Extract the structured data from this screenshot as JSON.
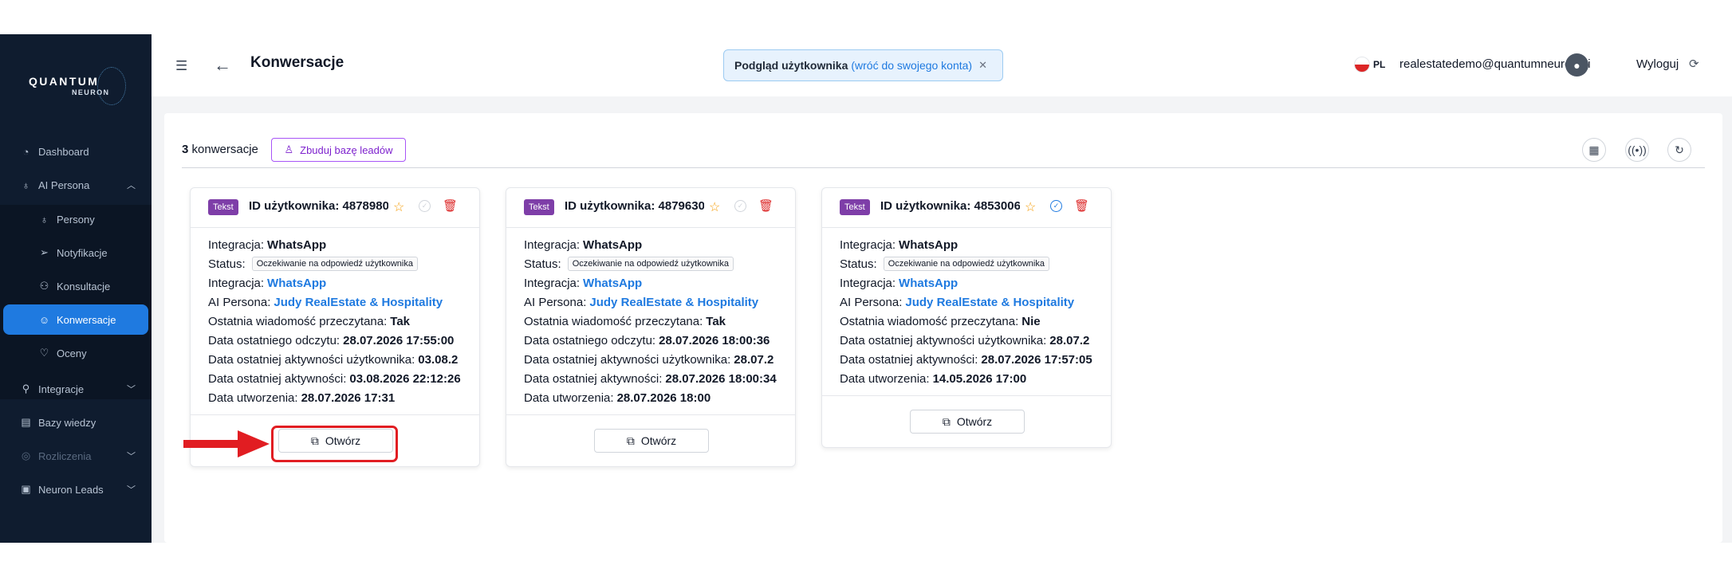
{
  "brand": {
    "name": "QUANTUM",
    "sub": "NEURON"
  },
  "sidebar": {
    "items": [
      {
        "label": "Dashboard"
      },
      {
        "label": "AI Persona"
      },
      {
        "label": "Persony"
      },
      {
        "label": "Notyfikacje"
      },
      {
        "label": "Konsultacje"
      },
      {
        "label": "Konwersacje"
      },
      {
        "label": "Oceny"
      },
      {
        "label": "Integracje"
      },
      {
        "label": "Bazy wiedzy"
      },
      {
        "label": "Rozliczenia"
      },
      {
        "label": "Neuron Leads"
      }
    ]
  },
  "header": {
    "title": "Konwersacje",
    "preview_strong": "Podgląd użytkownika",
    "preview_link": "(wróć do swojego konta)",
    "lang": "PL",
    "email": "realestatedemo@quantumneuron.ai",
    "logout": "Wyloguj"
  },
  "toolbar": {
    "count": "3",
    "count_suffix": "konwersacje",
    "build_label": "Zbuduj bazę leadów"
  },
  "cards": [
    {
      "badge": "Tekst",
      "id": "ID użytkownika: 4878980",
      "rows": [
        {
          "k": "Integracja:",
          "v": "WhatsApp"
        },
        {
          "k": "Status:",
          "v": "Oczekiwanie na odpowiedź użytkownika"
        },
        {
          "k": "Integracja:",
          "v": "WhatsApp"
        },
        {
          "k": "AI Persona:",
          "v": "Judy RealEstate & Hospitality"
        },
        {
          "k": "Ostatnia wiadomość przeczytana:",
          "v": "Tak"
        },
        {
          "k": "Data ostatniego odczytu:",
          "v": "28.07.2026 17:55:00"
        },
        {
          "k": "Data ostatniej aktywności użytkownika:",
          "v": "03.08.2"
        },
        {
          "k": "Data ostatniej aktywności:",
          "v": "03.08.2026 22:12:26"
        },
        {
          "k": "Data utworzenia:",
          "v": "28.07.2026 17:31"
        }
      ],
      "open_label": "Otwórz"
    },
    {
      "badge": "Tekst",
      "id": "ID użytkownika: 4879630",
      "rows": [
        {
          "k": "Integracja:",
          "v": "WhatsApp"
        },
        {
          "k": "Status:",
          "v": "Oczekiwanie na odpowiedź użytkownika"
        },
        {
          "k": "Integracja:",
          "v": "WhatsApp"
        },
        {
          "k": "AI Persona:",
          "v": "Judy RealEstate & Hospitality"
        },
        {
          "k": "Ostatnia wiadomość przeczytana:",
          "v": "Tak"
        },
        {
          "k": "Data ostatniego odczytu:",
          "v": "28.07.2026 18:00:36"
        },
        {
          "k": "Data ostatniej aktywności użytkownika:",
          "v": "28.07.2"
        },
        {
          "k": "Data ostatniej aktywności:",
          "v": "28.07.2026 18:00:34"
        },
        {
          "k": "Data utworzenia:",
          "v": "28.07.2026 18:00"
        }
      ],
      "open_label": "Otwórz"
    },
    {
      "badge": "Tekst",
      "id": "ID użytkownika: 4853006",
      "rows": [
        {
          "k": "Integracja:",
          "v": "WhatsApp"
        },
        {
          "k": "Status:",
          "v": "Oczekiwanie na odpowiedź użytkownika"
        },
        {
          "k": "Integracja:",
          "v": "WhatsApp"
        },
        {
          "k": "AI Persona:",
          "v": "Judy RealEstate & Hospitality"
        },
        {
          "k": "Ostatnia wiadomość przeczytana:",
          "v": "Nie"
        },
        {
          "k": "Data ostatniej aktywności użytkownika:",
          "v": "28.07.2"
        },
        {
          "k": "Data ostatniej aktywności:",
          "v": "28.07.2026 17:57:05"
        },
        {
          "k": "Data utworzenia:",
          "v": "14.05.2026 17:00"
        }
      ],
      "open_label": "Otwórz"
    }
  ],
  "colors": {
    "sidebar_bg": "#0f1c2f",
    "active": "#1f7ae0",
    "link": "#1f7ae0",
    "badge": "#7e3ea8",
    "highlight": "#e11d22"
  }
}
